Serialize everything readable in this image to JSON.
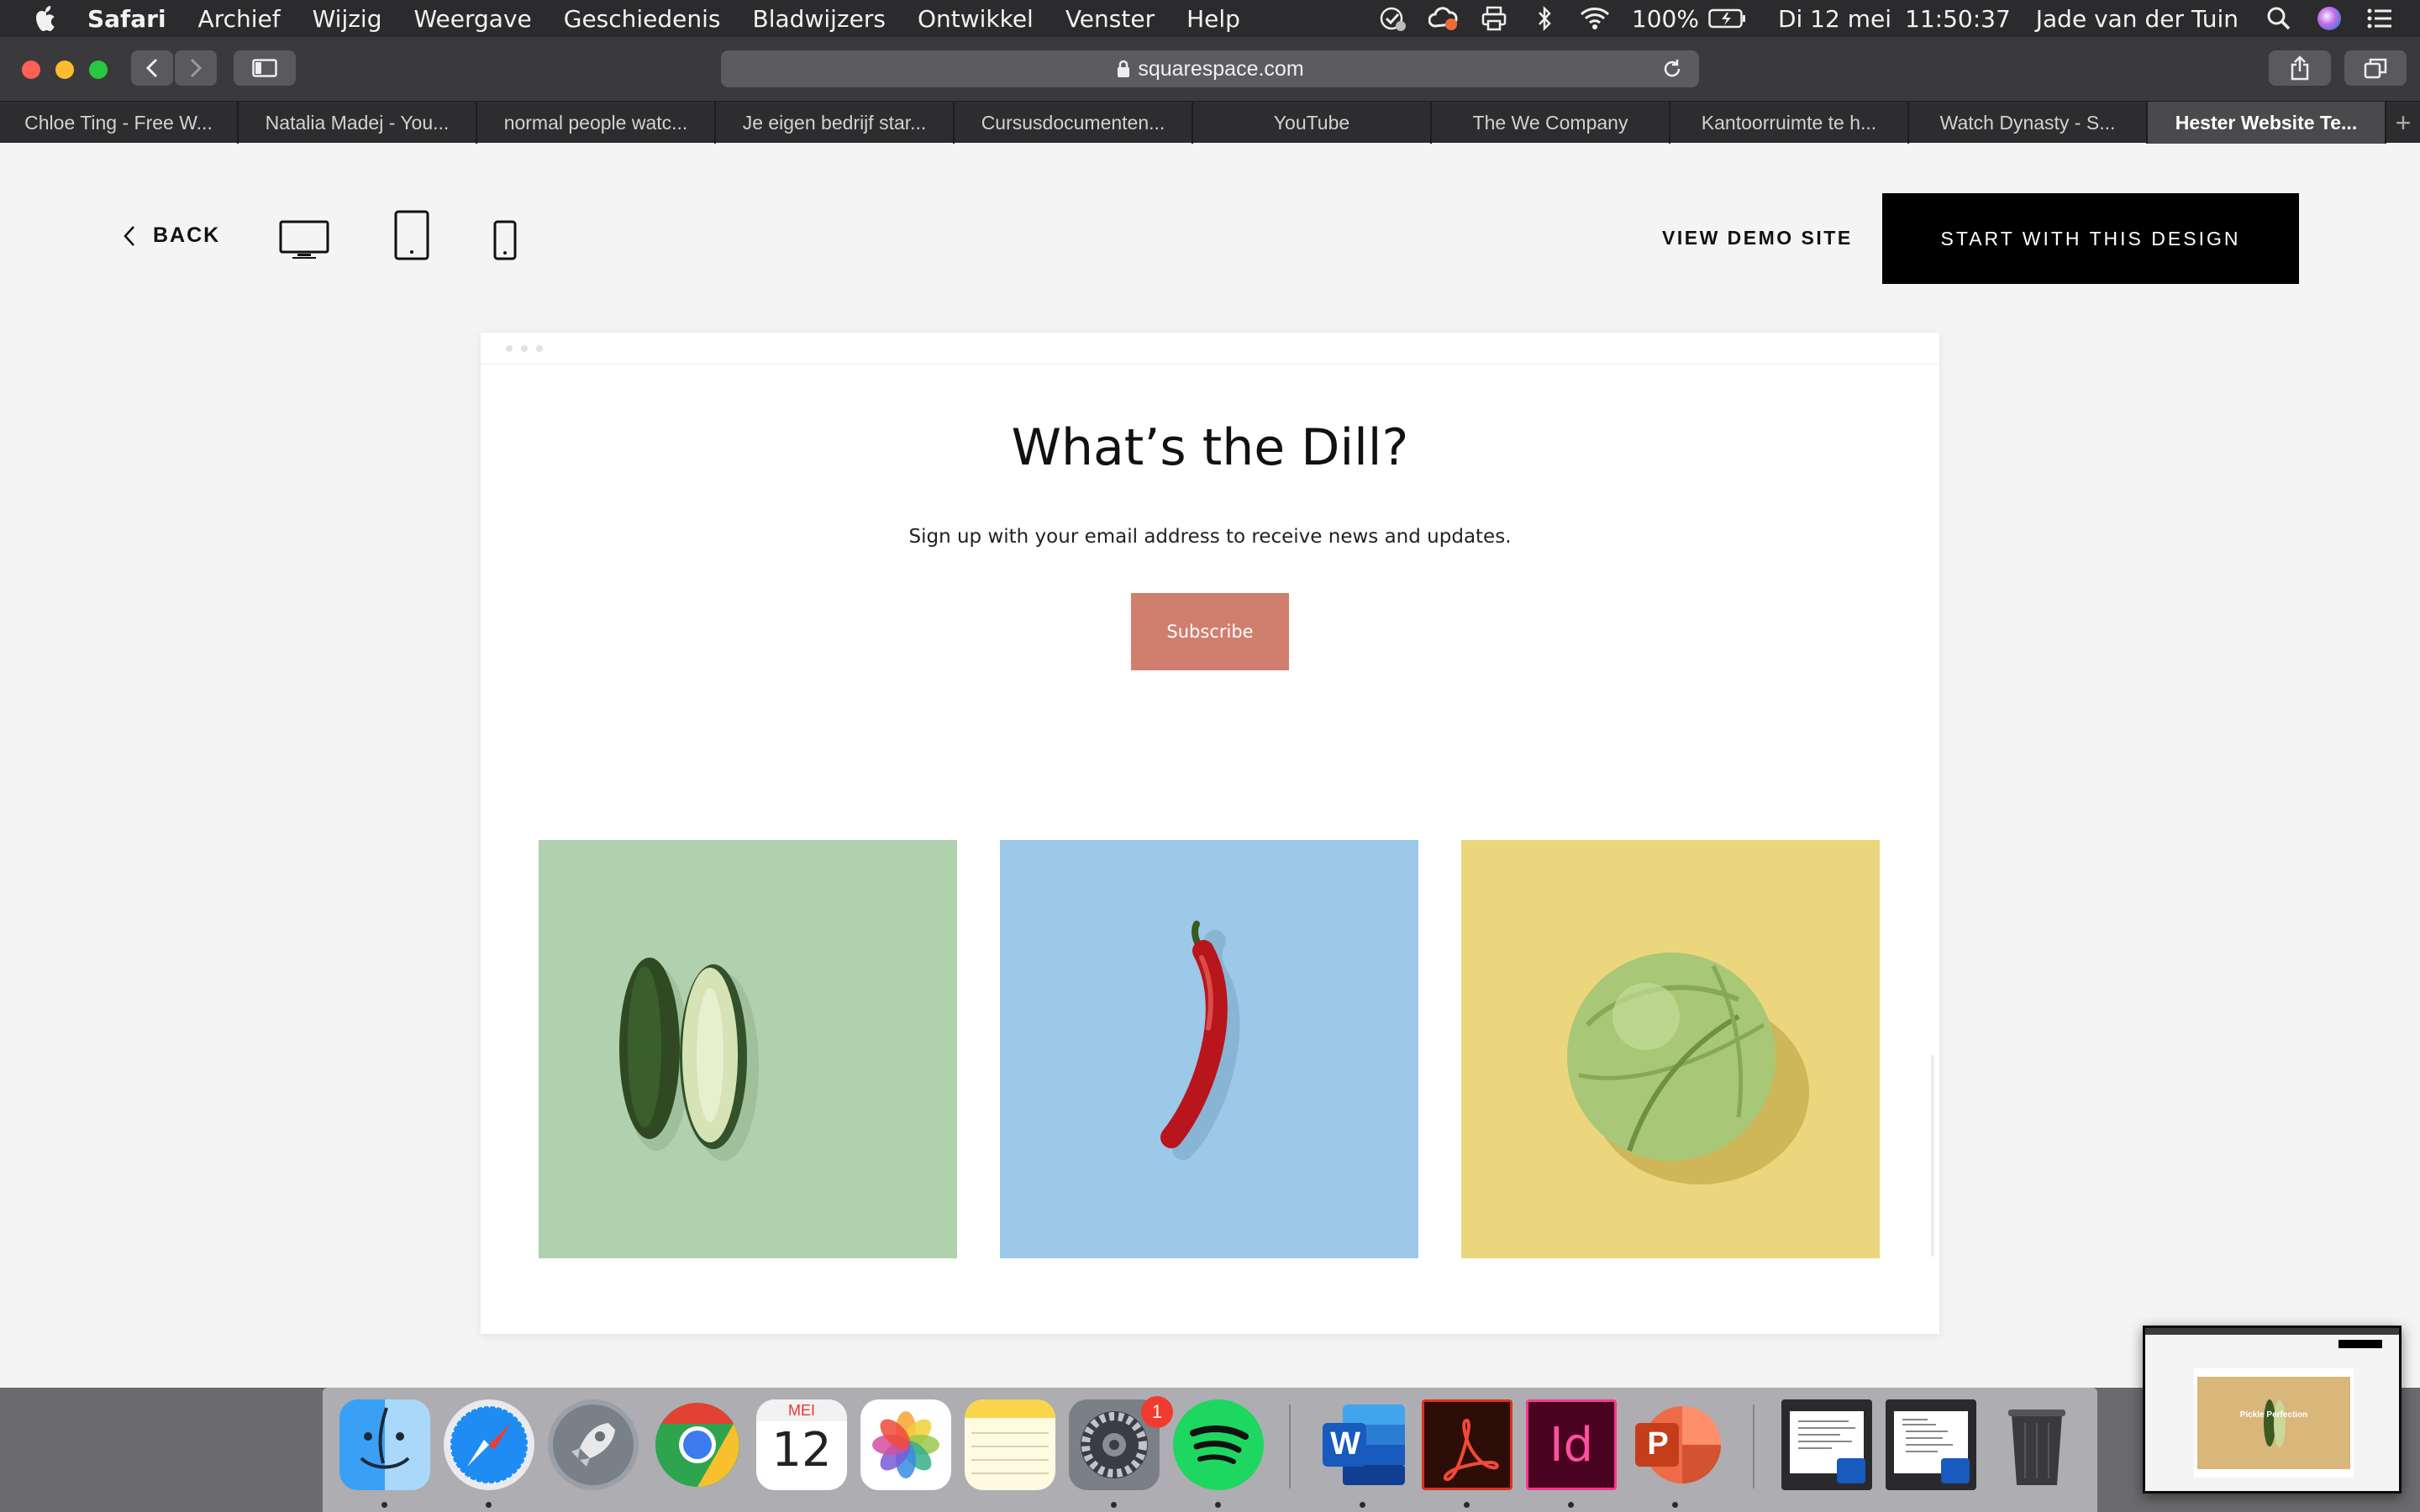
{
  "menubar": {
    "app_name": "Safari",
    "items": [
      "Archief",
      "Wijzig",
      "Weergave",
      "Geschiedenis",
      "Bladwijzers",
      "Ontwikkel",
      "Venster",
      "Help"
    ],
    "battery": "100%",
    "date": "Di 12 mei",
    "time": "11:50:37",
    "user": "Jade van der Tuin"
  },
  "browser": {
    "url": "squarespace.com",
    "tabs": [
      "Chloe Ting - Free W...",
      "Natalia Madej - You...",
      "normal people watc...",
      "Je eigen bedrijf star...",
      "Cursusdocumenten...",
      "YouTube",
      "The We Company",
      "Kantoorruimte te h...",
      "Watch Dynasty - S...",
      "Hester Website Te..."
    ],
    "active_tab_index": 9,
    "new_tab_label": "+"
  },
  "preview": {
    "back_label": "BACK",
    "view_demo_label": "VIEW DEMO SITE",
    "start_label": "START WITH THIS DESIGN",
    "devices": [
      "desktop-icon",
      "tablet-icon",
      "phone-icon"
    ]
  },
  "site": {
    "headline": "What’s the Dill?",
    "subline": "Sign up with your email address to receive news and updates.",
    "subscribe_label": "Subscribe",
    "tiles": [
      {
        "name": "cucumber-image",
        "background": "#afd1ad"
      },
      {
        "name": "chili-pepper-image",
        "background": "#9bc9e7"
      },
      {
        "name": "cabbage-image",
        "background": "#ecd67d"
      }
    ]
  },
  "dock": {
    "apps": [
      "Finder",
      "Safari",
      "Launchpad",
      "Chrome",
      "Calendar",
      "Photos",
      "Notes",
      "System Preferences",
      "Spotify",
      "Word",
      "Acrobat",
      "InDesign",
      "PowerPoint",
      "Word Document 1",
      "Word Document 2",
      "Trash"
    ],
    "calendar_month": "MEI",
    "calendar_day": "12",
    "system_prefs_badge": "1",
    "word_letter": "W",
    "indesign_letters": "Id",
    "powerpoint_letter": "P"
  },
  "thumbnail": {
    "caption": "Pickle Perfection"
  }
}
